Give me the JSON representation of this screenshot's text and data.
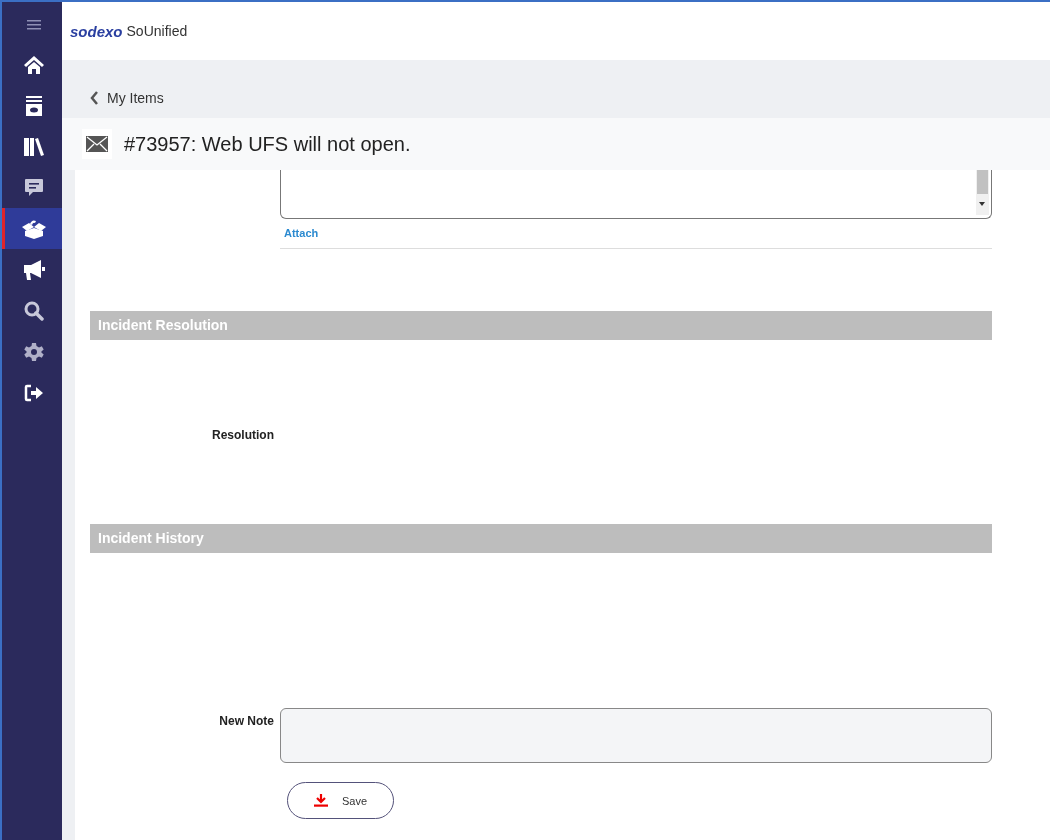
{
  "sidebar": {
    "items": [
      {
        "kind": "menu",
        "selected": false
      },
      {
        "kind": "home",
        "selected": false
      },
      {
        "kind": "archive",
        "selected": false
      },
      {
        "kind": "library",
        "selected": false
      },
      {
        "kind": "chat",
        "selected": false
      },
      {
        "kind": "box",
        "selected": true
      },
      {
        "kind": "megaphone",
        "selected": false
      },
      {
        "kind": "search",
        "selected": false
      },
      {
        "kind": "settings",
        "selected": false
      },
      {
        "kind": "logout",
        "selected": false
      }
    ]
  },
  "header": {
    "logo": "sodexo",
    "app_name": "SoUnified"
  },
  "breadcrumb": {
    "back_label": "My Items"
  },
  "ticket": {
    "title": "#73957: Web UFS will not open."
  },
  "attach_link": "Attach",
  "sections": [
    {
      "title": "Incident Resolution",
      "field_label": "Resolution"
    },
    {
      "title": "Incident History"
    }
  ],
  "new_note": {
    "label": "New Note"
  },
  "save_button": "Save"
}
